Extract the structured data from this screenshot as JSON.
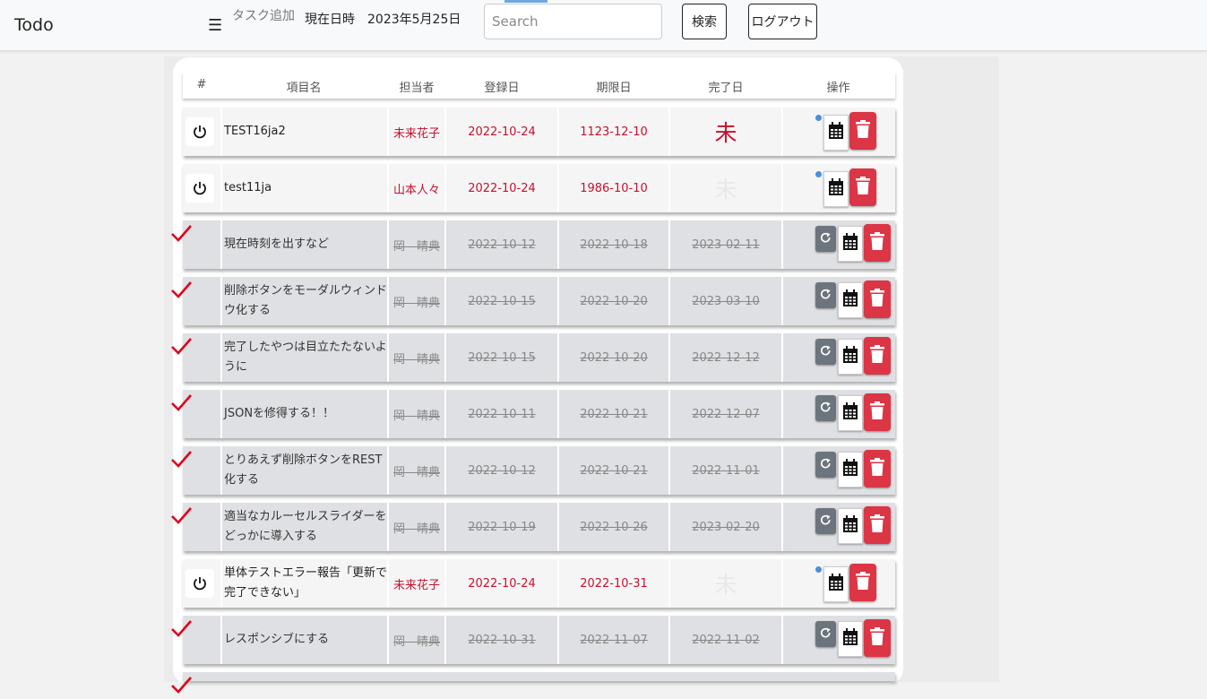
{
  "navbar": {
    "brand": "Todo",
    "menu_icon": "hamburger-icon",
    "add_task_label": "タスク追加",
    "current_datetime": "現在日時　2023年5月25日",
    "search_placeholder": "Search",
    "search_button": "検索",
    "logout_button": "ログアウト"
  },
  "table": {
    "headers": [
      "#",
      "項目名",
      "担当者",
      "登録日",
      "期限日",
      "完了日",
      "操作"
    ],
    "rows": [
      {
        "name": "TEST16ja2",
        "assignee": "未来花子",
        "registered": "2022-10-24",
        "due": "1123-12-10",
        "completed": "未",
        "status": "active"
      },
      {
        "name": "test11ja",
        "assignee": "山本人々",
        "registered": "2022-10-24",
        "due": "1986-10-10",
        "completed": "未",
        "status": "active"
      },
      {
        "name": "現在時刻を出すなど",
        "assignee": "岡　晴典",
        "registered": "2022-10-12",
        "due": "2022-10-18",
        "completed": "2023-02-11",
        "status": "done"
      },
      {
        "name": "削除ボタンをモーダルウィンドウ化する",
        "assignee": "岡　晴典",
        "registered": "2022-10-15",
        "due": "2022-10-20",
        "completed": "2023-03-10",
        "status": "done"
      },
      {
        "name": "完了したやつは目立たたないように",
        "assignee": "岡　晴典",
        "registered": "2022-10-15",
        "due": "2022-10-20",
        "completed": "2022-12-12",
        "status": "done"
      },
      {
        "name": "JSONを修得する！！",
        "assignee": "岡　晴典",
        "registered": "2022-10-11",
        "due": "2022-10-21",
        "completed": "2022-12-07",
        "status": "done"
      },
      {
        "name": "とりあえず削除ボタンをREST化する",
        "assignee": "岡　晴典",
        "registered": "2022-10-12",
        "due": "2022-10-21",
        "completed": "2022-11-01",
        "status": "done"
      },
      {
        "name": "適当なカルーセルスライダーをどっかに導入する",
        "assignee": "岡　晴典",
        "registered": "2022-10-19",
        "due": "2022-10-26",
        "completed": "2023-02-20",
        "status": "done"
      },
      {
        "name": "単体テストエラー報告「更新で完了できない」",
        "assignee": "未来花子",
        "registered": "2022-10-24",
        "due": "2022-10-31",
        "completed": "未",
        "status": "active"
      },
      {
        "name": "レスポンシブにする",
        "assignee": "岡　晴典",
        "registered": "2022-10-31",
        "due": "2022-11-07",
        "completed": "2022-11-02",
        "status": "done"
      }
    ]
  },
  "colors": {
    "accent_red": "#c8102e",
    "delete_red": "#dc3545",
    "done_bg": "#dfe0e3",
    "active_bg": "#f5f5f5"
  }
}
